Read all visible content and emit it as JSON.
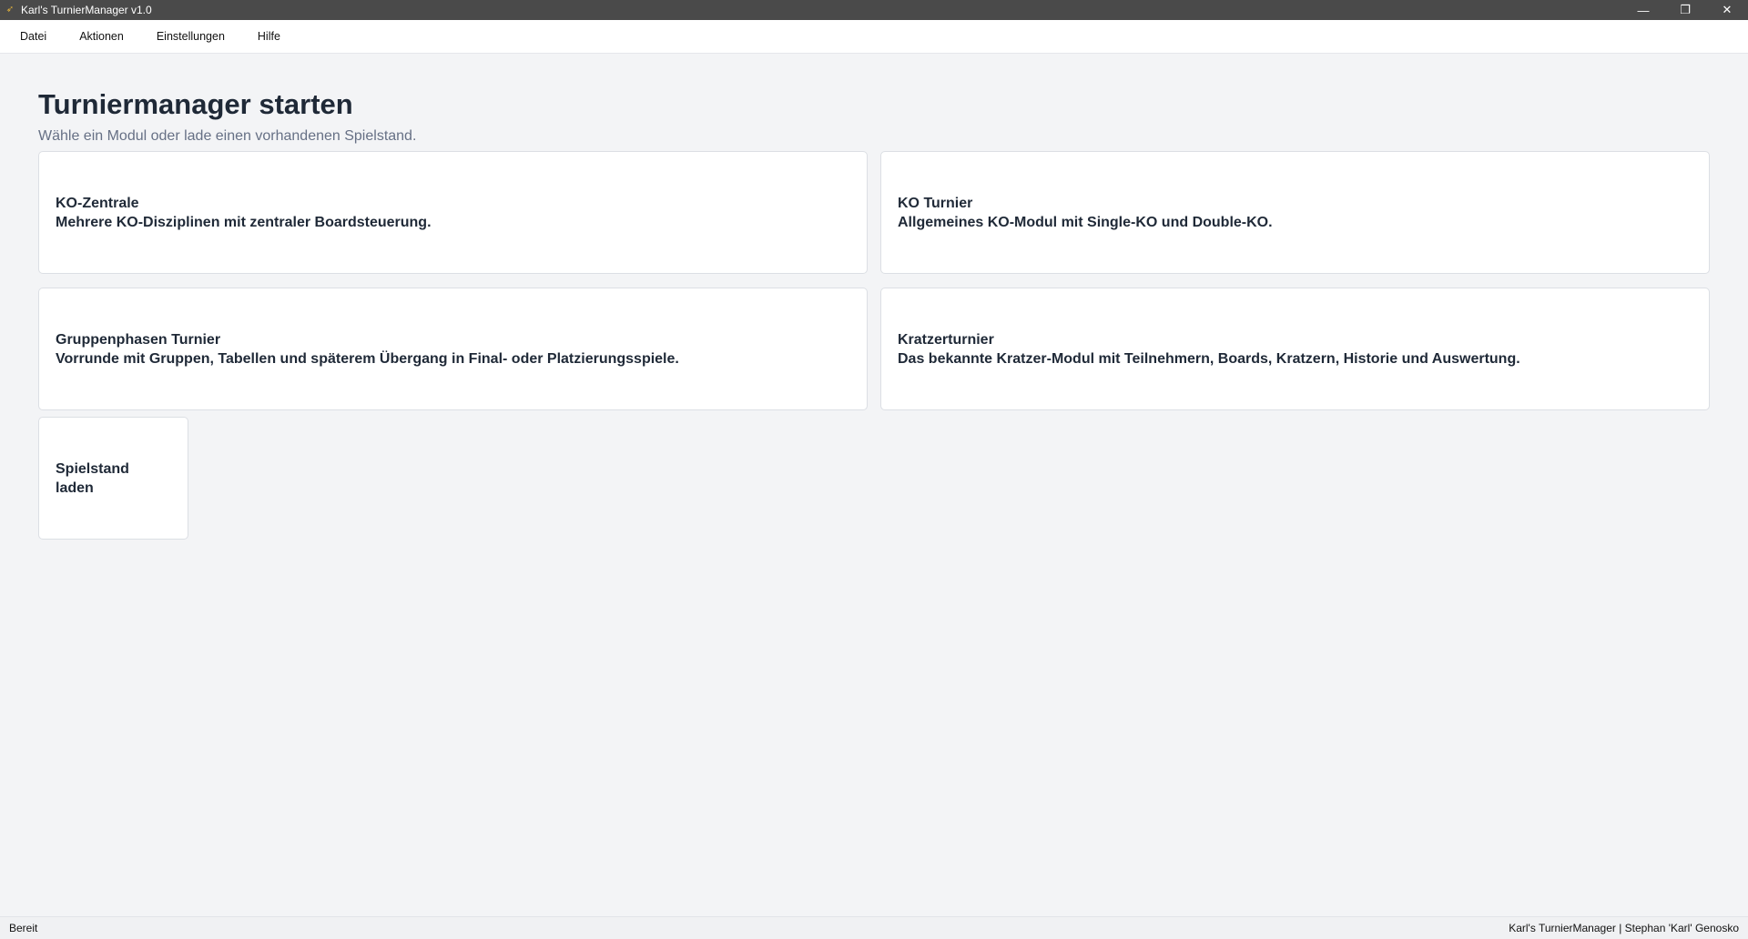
{
  "window": {
    "title": "Karl's TurnierManager v1.0",
    "controls": {
      "minimize": "—",
      "restore": "❐",
      "close": "✕"
    }
  },
  "menu": [
    "Datei",
    "Aktionen",
    "Einstellungen",
    "Hilfe"
  ],
  "page": {
    "title": "Turniermanager starten",
    "subtitle": "Wähle ein Modul oder lade einen vorhandenen Spielstand."
  },
  "modules": [
    {
      "title": "KO-Zentrale",
      "description": "Mehrere KO-Disziplinen mit zentraler Boardsteuerung."
    },
    {
      "title": "KO Turnier",
      "description": "Allgemeines KO-Modul mit Single-KO und Double-KO."
    },
    {
      "title": "Gruppenphasen Turnier",
      "description": "Vorrunde mit Gruppen, Tabellen und späterem Übergang in Final- oder Platzierungsspiele."
    },
    {
      "title": "Kratzerturnier",
      "description": "Das bekannte Kratzer-Modul mit Teilnehmern, Boards, Kratzern, Historie und Auswertung."
    }
  ],
  "load_card": {
    "label": "Spielstand laden"
  },
  "status": {
    "left": "Bereit",
    "right": "Karl's TurnierManager | Stephan 'Karl' Genosko"
  },
  "colors": {
    "titlebar": "#4a4a4a",
    "background": "#f3f4f6",
    "card": "#ffffff",
    "text": "#1f2937",
    "subtitle": "#667085"
  }
}
